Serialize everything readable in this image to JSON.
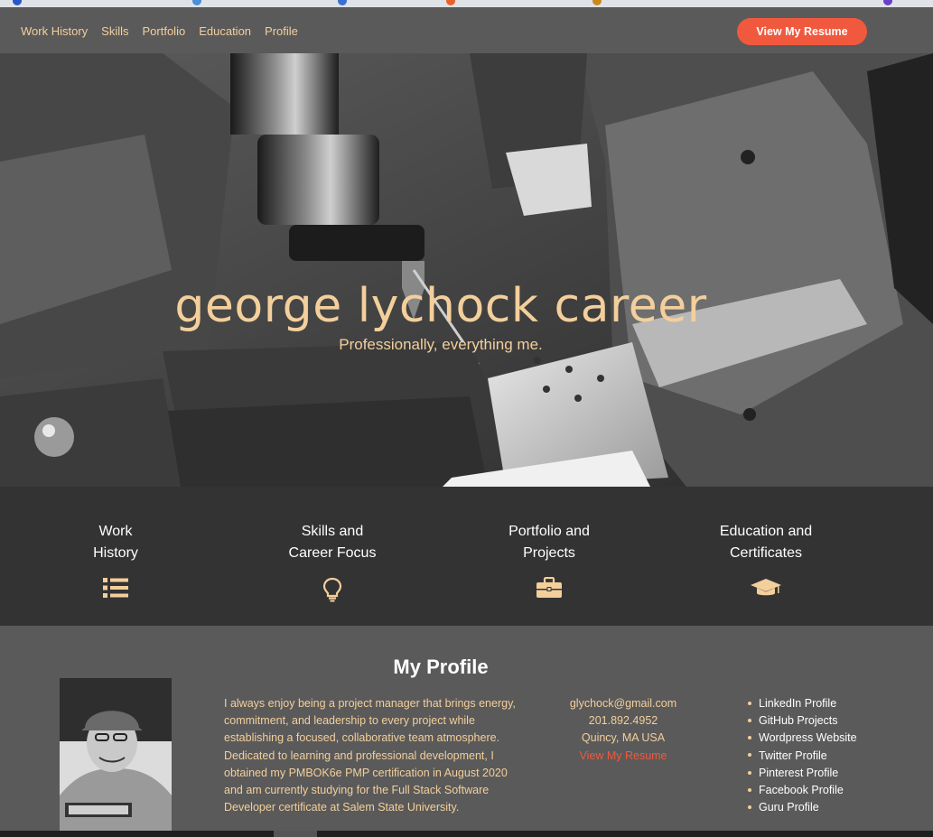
{
  "nav": {
    "links": [
      "Work History",
      "Skills",
      "Portfolio",
      "Education",
      "Profile"
    ],
    "resume_button": "View My Resume"
  },
  "hero": {
    "title": "george lychock career",
    "subtitle": "Professionally, everything me."
  },
  "features": [
    {
      "title_line1": "Work",
      "title_line2": "History",
      "icon": "list-icon"
    },
    {
      "title_line1": "Skills and",
      "title_line2": "Career Focus",
      "icon": "lightbulb-icon"
    },
    {
      "title_line1": "Portfolio and",
      "title_line2": "Projects",
      "icon": "briefcase-icon"
    },
    {
      "title_line1": "Education and",
      "title_line2": "Certificates",
      "icon": "graduation-cap-icon"
    }
  ],
  "profile": {
    "heading": "My Profile",
    "bio": "I always enjoy being a project manager that brings energy, commitment, and leadership to every project while establishing a focused, collaborative team atmosphere. Dedicated to learning and professional development, I obtained my PMBOK6e PMP certification in August 2020 and am currently studying for the Full Stack Software Developer certificate at Salem State University.",
    "contact": {
      "email": "glychock@gmail.com",
      "phone": "201.892.4952",
      "location": "Quincy, MA USA",
      "resume_link": "View My Resume"
    },
    "links": [
      "LinkedIn Profile",
      "GitHub Projects",
      "Wordpress Website",
      "Twitter Profile",
      "Pinterest Profile",
      "Facebook Profile",
      "Guru Profile"
    ]
  },
  "colors": {
    "accent": "#f0593e",
    "tan": "#f3cf9c",
    "nav_bg": "#5a5a5a",
    "features_bg": "#333333"
  }
}
